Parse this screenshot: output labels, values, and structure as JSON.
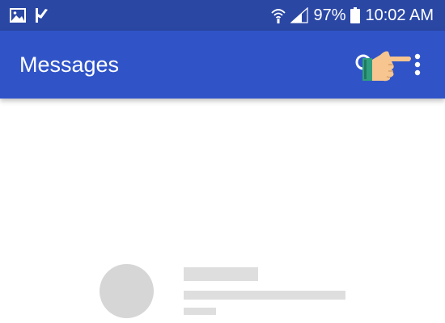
{
  "status_bar": {
    "battery": "97%",
    "time": "10:02 AM",
    "icons": [
      "image-icon",
      "checkmark-flag-icon",
      "wifi-icon",
      "signal-icon",
      "battery-icon"
    ],
    "bg_color": "#2a47a4"
  },
  "app_bar": {
    "title": "Messages",
    "bg_color": "#3054c8",
    "actions": [
      "search-icon",
      "pointing-hand-icon",
      "more-vert-icon"
    ]
  },
  "content": {
    "state": "loading-placeholder",
    "placeholder_color": "#d6d6d6"
  }
}
